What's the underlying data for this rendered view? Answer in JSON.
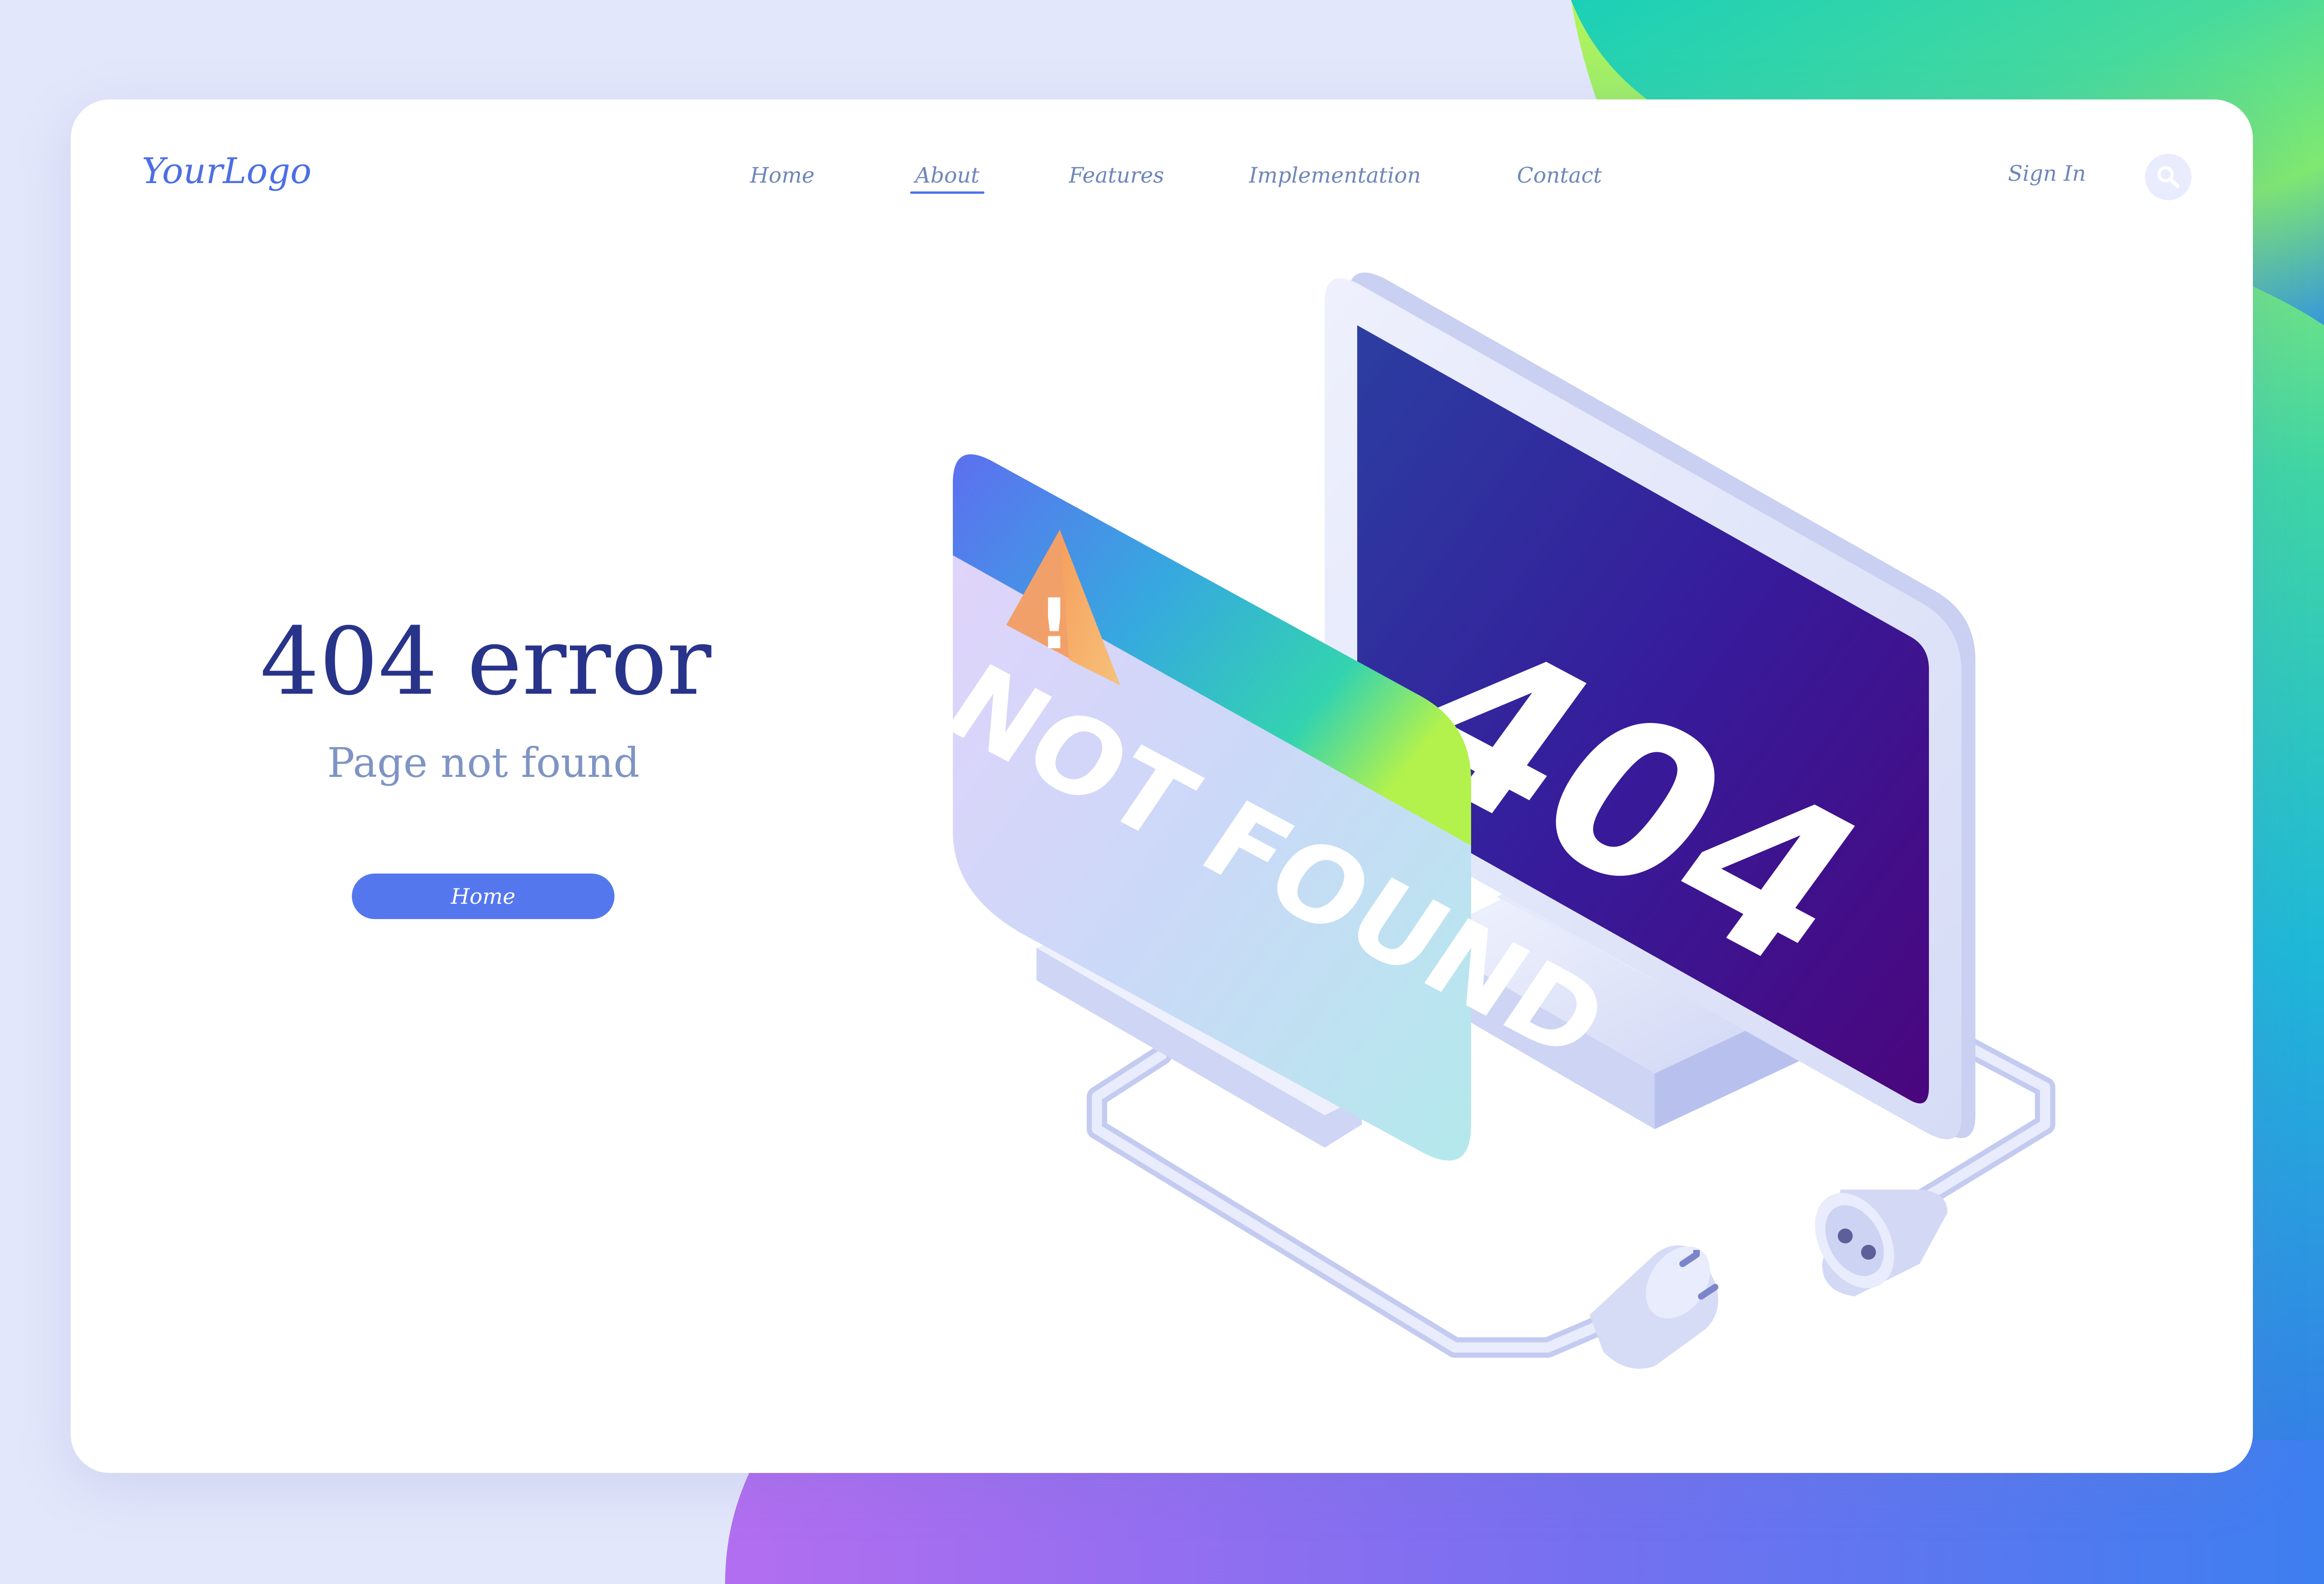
{
  "brand": {
    "logo_text": "YourLogo"
  },
  "nav": {
    "items": [
      {
        "label": "Home"
      },
      {
        "label": "About",
        "active": true
      },
      {
        "label": "Features"
      },
      {
        "label": "Implementation"
      },
      {
        "label": "Contact"
      }
    ],
    "sign_in_label": "Sign In",
    "search_icon": "search-icon"
  },
  "hero": {
    "title": "404 error",
    "subtitle": "Page not found",
    "button_label": "Home"
  },
  "illustration": {
    "warning_mark": "!",
    "panel_text": "NOT FOUND",
    "monitor_text": "404",
    "icons": [
      "warning-icon",
      "monitor-icon",
      "plug-icon",
      "socket-icon"
    ]
  },
  "colors": {
    "accent": "#5577ee",
    "title": "#28338a",
    "subtitle": "#7f94c5",
    "nav": "#6f86b8",
    "background": "#e3e7fb",
    "monitor_screen_top": "#2c3fa0",
    "monitor_screen_bottom": "#46067e"
  }
}
